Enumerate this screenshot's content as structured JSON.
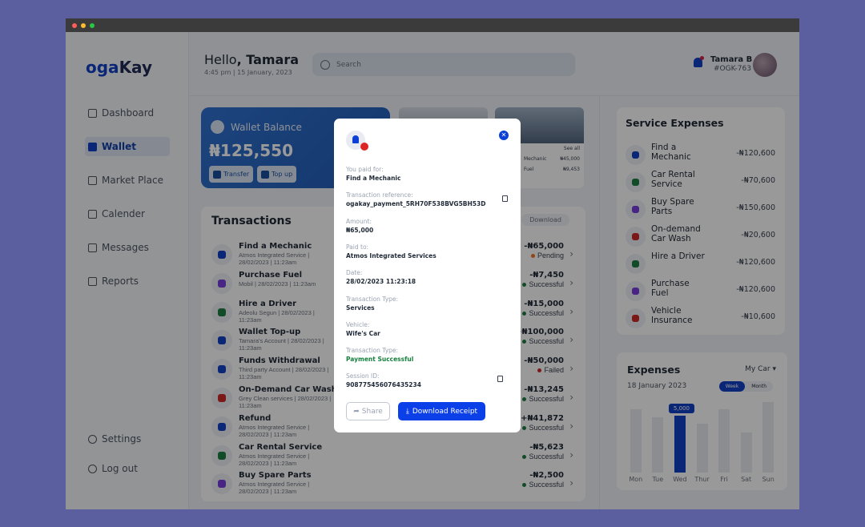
{
  "brand": {
    "name_prefix": "oga",
    "name_suffix": "Kay"
  },
  "sidebar": {
    "items": [
      {
        "label": "Dashboard",
        "icon": "grid-icon"
      },
      {
        "label": "Wallet",
        "icon": "wallet-icon",
        "active": true
      },
      {
        "label": "Market Place",
        "icon": "store-icon"
      },
      {
        "label": "Calender",
        "icon": "calendar-icon"
      },
      {
        "label": "Messages",
        "icon": "message-icon"
      },
      {
        "label": "Reports",
        "icon": "chart-pie-icon"
      }
    ],
    "bottom": [
      {
        "label": "Settings",
        "icon": "gear-icon"
      },
      {
        "label": "Log out",
        "icon": "logout-icon"
      }
    ]
  },
  "header": {
    "greeting": "Hello",
    "name": ", Tamara",
    "datetime": "4:45 pm | 15 January, 2023",
    "search_placeholder": "Search",
    "user_name": "Tamara B",
    "user_id": "#OGK-763"
  },
  "wallet": {
    "title": "Wallet Balance",
    "balance": "₦125,550",
    "transfer": "Transfer",
    "topup": "Top up"
  },
  "car_card": {
    "see_all": "See all",
    "rows": [
      {
        "name": "Mechanic",
        "amount": "₦45,000"
      },
      {
        "name": "Fuel",
        "amount": "₦9,453"
      }
    ]
  },
  "transactions": {
    "title": "Transactions",
    "download": "Download",
    "rows": [
      {
        "name": "Find a Mechanic",
        "sub": "Atmos Integrated Service | 28/02/2023 | 11:23am",
        "amount": "-₦65,000",
        "status": "Pending",
        "color": "#f97316",
        "icolor": "#0b3fd6"
      },
      {
        "name": "Purchase Fuel",
        "sub": "Mobil | 28/02/2023 | 11:23am",
        "amount": "-₦7,450",
        "status": "Successful",
        "color": "#15803d",
        "icolor": "#7c3aed"
      },
      {
        "name": "Hire a Driver",
        "sub": "Adeolu Segun | 28/02/2023 | 11:23am",
        "amount": "-₦15,000",
        "status": "Successful",
        "color": "#15803d",
        "icolor": "#15803d"
      },
      {
        "name": "Wallet Top-up",
        "sub": "Tamara's Account | 28/02/2023 | 11:23am",
        "amount": "+₦100,000",
        "status": "Successful",
        "color": "#15803d",
        "icolor": "#0b3fd6"
      },
      {
        "name": "Funds Withdrawal",
        "sub": "Third party Account | 28/02/2023 | 11:23am",
        "amount": "-₦50,000",
        "status": "Failed",
        "color": "#dc2626",
        "icolor": "#0b3fd6"
      },
      {
        "name": "On-Demand Car Wash",
        "sub": "Grey Clean services | 28/02/2023 | 11:23am",
        "amount": "-₦13,245",
        "status": "Successful",
        "color": "#15803d",
        "icolor": "#dc2626"
      },
      {
        "name": "Refund",
        "sub": "Atmos Integrated Service | 28/02/2023 | 11:23am",
        "amount": "+₦41,872",
        "status": "Successful",
        "color": "#15803d",
        "icolor": "#0b3fd6"
      },
      {
        "name": "Car Rental Service",
        "sub": "Atmos Integrated Service | 28/02/2023 | 11:23am",
        "amount": "-₦5,623",
        "status": "Successful",
        "color": "#15803d",
        "icolor": "#15803d"
      },
      {
        "name": "Buy Spare Parts",
        "sub": "Atmos Integrated Service | 28/02/2023 | 11:23am",
        "amount": "-₦2,500",
        "status": "Successful",
        "color": "#15803d",
        "icolor": "#7c3aed"
      }
    ]
  },
  "service_expenses": {
    "title": "Service Expenses",
    "rows": [
      {
        "name": "Find a Mechanic",
        "amount": "-₦120,600",
        "icolor": "#0b3fd6"
      },
      {
        "name": "Car Rental Service",
        "amount": "-₦70,600",
        "icolor": "#15803d"
      },
      {
        "name": "Buy Spare Parts",
        "amount": "-₦150,600",
        "icolor": "#7c3aed"
      },
      {
        "name": "On-demand Car Wash",
        "amount": "-₦20,600",
        "icolor": "#dc2626"
      },
      {
        "name": "Hire a Driver",
        "amount": "-₦120,600",
        "icolor": "#15803d"
      },
      {
        "name": "Purchase Fuel",
        "amount": "-₦120,600",
        "icolor": "#7c3aed"
      },
      {
        "name": "Vehicle Insurance",
        "amount": "-₦10,600",
        "icolor": "#dc2626"
      }
    ]
  },
  "expenses": {
    "title": "Expenses",
    "date": "18 January 2023",
    "vehicle": "My Car",
    "toggle": [
      "Week",
      "Month"
    ]
  },
  "chart_data": {
    "type": "bar",
    "categories": [
      "Mon",
      "Tue",
      "Wed",
      "Thur",
      "Fri",
      "Sat",
      "Sun"
    ],
    "values": [
      5600,
      4900,
      5000,
      4300,
      5600,
      3500,
      6200
    ],
    "selected": "Wed",
    "selected_label": "5,000",
    "ylim": [
      0,
      6500
    ]
  },
  "modal": {
    "fields": [
      {
        "label": "You paid for:",
        "value": "Find a Mechanic"
      },
      {
        "label": "Transaction reference:",
        "value": "ogakay_payment_5RH70F538BVG5BH53D",
        "copy": true
      },
      {
        "label": "Amount:",
        "value": "₦65,000"
      },
      {
        "label": "Paid to:",
        "value": "Atmos Integrated Services"
      },
      {
        "label": "Date:",
        "value": "28/02/2023   11:23:18"
      },
      {
        "label": "Transaction Type:",
        "value": "Services"
      },
      {
        "label": "Vehicle:",
        "value": "Wife's Car"
      },
      {
        "label": "Transaction Type:",
        "value": "Payment Successful",
        "ok": true
      },
      {
        "label": "Session ID:",
        "value": "908775456076435234",
        "copy": true
      }
    ],
    "share": "Share",
    "download": "Download Receipt"
  }
}
